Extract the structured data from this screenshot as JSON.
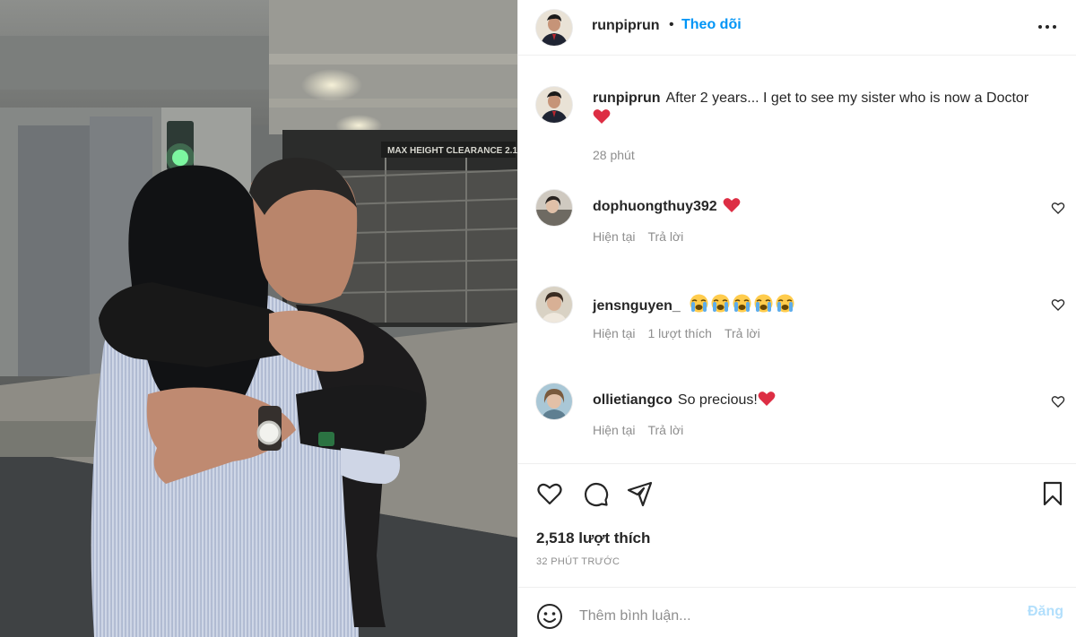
{
  "post": {
    "author": "runpiprun",
    "separator": "•",
    "follow_label": "Theo dõi",
    "caption": {
      "username": "runpiprun",
      "text": "After 2 years... I get to see my sister who is now a Doctor",
      "time": "28 phút"
    },
    "comments": [
      {
        "username": "dophuongthuy392",
        "text": "",
        "time": "Hiện tại",
        "likes": "",
        "reply": "Trả lời",
        "emojis": [
          "red-heart"
        ]
      },
      {
        "username": "jensnguyen_",
        "text": "",
        "time": "Hiện tại",
        "likes": "1 lượt thích",
        "reply": "Trả lời",
        "emojis": [
          "loudly-crying-face",
          "loudly-crying-face",
          "loudly-crying-face",
          "loudly-crying-face",
          "loudly-crying-face"
        ]
      },
      {
        "username": "ollietiangco",
        "text": "So precious!",
        "time": "Hiện tại",
        "likes": "",
        "reply": "Trả lời",
        "emojis": [
          "red-heart"
        ]
      }
    ],
    "likes": "2,518 lượt thích",
    "posted": "32 phút trước",
    "comment_placeholder": "Thêm bình luận...",
    "post_label": "Đăng"
  },
  "colors": {
    "link_blue": "#0095f6",
    "post_disabled": "#b2dffc",
    "secondary_text": "#8e8e8e",
    "heart_red": "#ed4956"
  },
  "photo": {
    "sign_text": "MAX HEIGHT CLEARANCE 2.1"
  }
}
